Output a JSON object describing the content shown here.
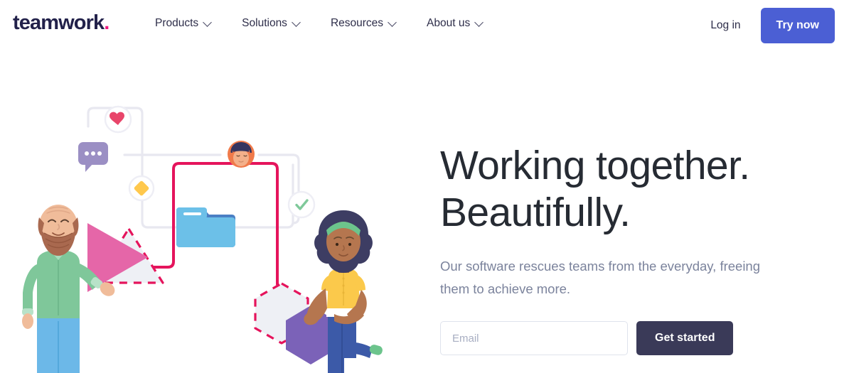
{
  "header": {
    "logo_text": "teamwork",
    "logo_dot": ".",
    "nav_items": [
      {
        "label": "Products",
        "icon": "chevron-down-icon"
      },
      {
        "label": "Solutions",
        "icon": "chevron-down-icon"
      },
      {
        "label": "Resources",
        "icon": "chevron-down-icon"
      },
      {
        "label": "About us",
        "icon": "chevron-down-icon"
      }
    ],
    "login_label": "Log in",
    "try_now_label": "Try now"
  },
  "hero": {
    "headline_line1": "Working together.",
    "headline_line2": "Beautifully.",
    "subhead": "Our software rescues teams from the everyday, freeing them to achieve more.",
    "email_placeholder": "Email",
    "email_value": "",
    "cta_label": "Get started"
  },
  "illustration": {
    "alt": "Two people assembling geometric shapes connected by a workflow diagram",
    "icons": [
      "heart-icon",
      "chat-bubble-icon",
      "diamond-icon",
      "avatar-icon",
      "check-circle-icon",
      "folder-icon"
    ]
  },
  "colors": {
    "brand_navy": "#22214a",
    "brand_pink": "#f0197d",
    "accent_blue": "#4b5fd4",
    "cta_dark": "#3a3a58",
    "heading": "#262b33",
    "body_text": "#7b839c",
    "line_gray": "#e8e8f0",
    "line_pink": "#e5145c",
    "heart_pink": "#e8456a",
    "bubble_purple": "#9b8fc4",
    "diamond_yellow": "#ffc84d",
    "check_green": "#7fc99a",
    "folder_blue": "#6cc0e8",
    "folder_blue_dark": "#4a7fc4",
    "triangle_pink": "#e566a8",
    "hexagon_purple": "#7b62b8",
    "shirt_green": "#7fc79a",
    "pants_blue": "#6cb8e8",
    "beard_brown": "#a9694f",
    "skin_light": "#f0bc9a",
    "skin_dark": "#b5764f",
    "hair_navy": "#3d3d63",
    "top_yellow": "#fbc94b",
    "pants_indigo": "#3c5aa8",
    "headband_green": "#6cc48c",
    "avatar_orange": "#f07a4a"
  }
}
